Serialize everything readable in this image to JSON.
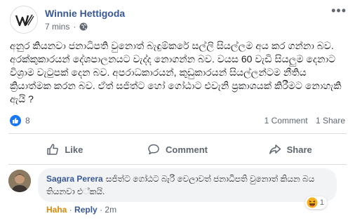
{
  "post": {
    "author": "Winnie Hettigoda",
    "time": "7 mins",
    "separator": "·",
    "text": "අනුර කියනවා ජනාධිපති වුනොත් බැඳුම්කරේ සල්ලි සියල්ලම අය කර ගන්නා බව. අරක්කුකාරයන් දේශපාලනයට වැද්ද නොගන්න බව. වයස 60 වැඩි සියලුම දෙනාට විශ්‍රාම වැටුපක් දෙන බව. අපරාධකාරයන්, කුඩුකාරයන් සියල්ලන්ටම නීතිය ක්‍රියාත්මක කරන බව. ඒත් සජිත්ට හෝ ගෝඨාට එවැනි ප්‍රකාශයක් කිරීමට නොහැකි ඇයි ?"
  },
  "stats": {
    "reactions": "8",
    "comments": "1 Comment",
    "shares": "1 Share"
  },
  "actions": {
    "like": "Like",
    "comment": "Comment",
    "share": "Share"
  },
  "comment": {
    "author": "Sagara Perera",
    "text": "සජිත්ට ගෝඨට බැරි වෙලාවත් ජනාධිපති වුනොත් කියන බය තියනවා එ්කයි.",
    "reaction": "Haha",
    "reply": "Reply",
    "separator": "·",
    "time": "2m",
    "reaction_count": "1"
  },
  "colors": {
    "link": "#385898",
    "like_blue": "#1877f2",
    "secondary_text": "#606770",
    "haha": "#d88a00"
  },
  "icons": [
    "globe-icon",
    "more-icon",
    "like-badge-icon",
    "like-icon",
    "comment-icon",
    "share-icon",
    "haha-icon"
  ]
}
